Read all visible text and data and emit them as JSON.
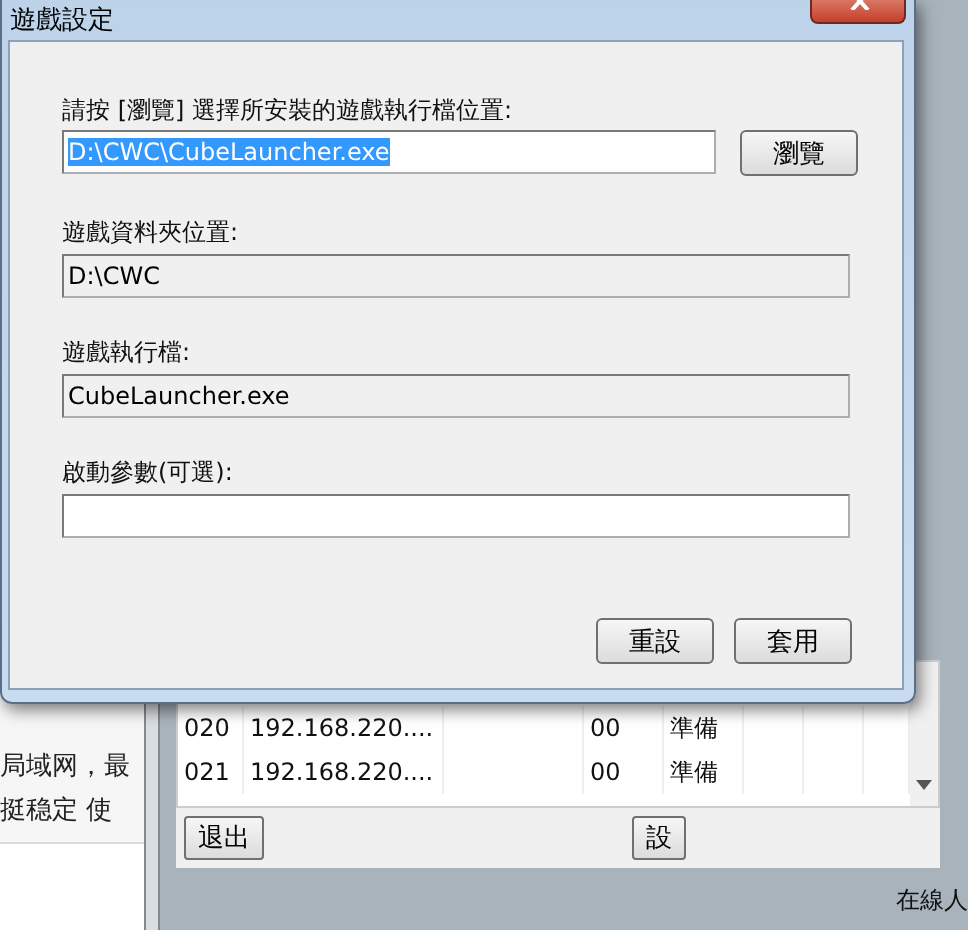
{
  "dialog": {
    "title": "遊戲設定",
    "prompt": "請按 [瀏覽] 選擇所安裝的遊戲執行檔位置:",
    "path_field": {
      "value": "D:\\CWC\\CubeLauncher.exe",
      "text_selected": true
    },
    "browse_button": "瀏覽",
    "fields": [
      {
        "label": "遊戲資料夾位置:",
        "value": "D:\\CWC",
        "disabled": true
      },
      {
        "label": "遊戲執行檔:",
        "value": "CubeLauncher.exe",
        "disabled": true
      },
      {
        "label": "啟動參數(可選):",
        "disabled": false
      }
    ],
    "buttons": [
      "重設",
      "套用"
    ]
  },
  "background": {
    "page_lines": [
      "局域网，最",
      "挺稳定 使"
    ],
    "list_rows": [
      {
        "number": "020",
        "address": "192.168.220....",
        "column_4": "00",
        "status": "準備"
      },
      {
        "number": "021",
        "address": "192.168.220....",
        "column_4": "00",
        "status": "準備"
      }
    ],
    "buttons": [
      "退出",
      "設"
    ],
    "status_text": "在線人"
  }
}
